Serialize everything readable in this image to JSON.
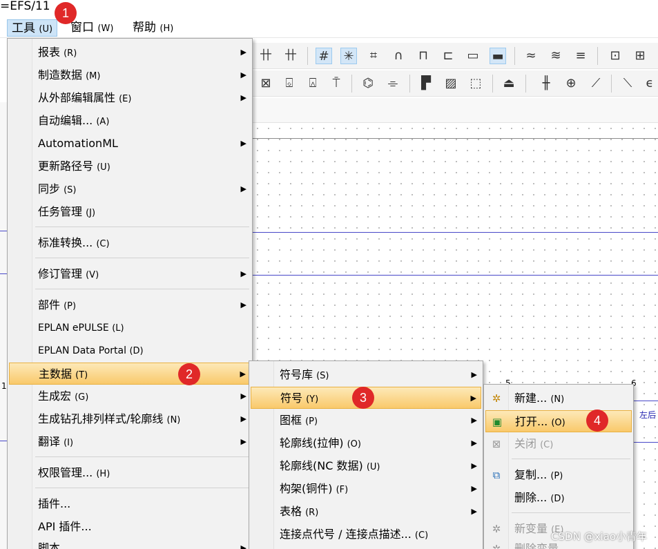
{
  "window": {
    "title": "=EFS/11"
  },
  "menubar": [
    {
      "label": "工具",
      "acc": "(U)",
      "active": true
    },
    {
      "label": "窗口",
      "acc": "(W)"
    },
    {
      "label": "帮助",
      "acc": "(H)"
    }
  ],
  "tools_menu": [
    {
      "label": "报表",
      "acc": "(R)",
      "submenu": true
    },
    {
      "label": "制造数据",
      "acc": "(M)",
      "submenu": true
    },
    {
      "label": "从外部编辑属性",
      "acc": "(E)",
      "submenu": true
    },
    {
      "label": "自动编辑...",
      "acc": "(A)"
    },
    {
      "label": "AutomationML",
      "acc": "",
      "submenu": true
    },
    {
      "label": "更新路径号",
      "acc": "(U)"
    },
    {
      "label": "同步",
      "acc": "(S)",
      "submenu": true
    },
    {
      "label": "任务管理",
      "acc": "(J)"
    },
    {
      "label": "标准转换...",
      "acc": "(C)"
    },
    {
      "label": "修订管理",
      "acc": "(V)",
      "submenu": true
    },
    {
      "label": "部件",
      "acc": "(P)",
      "submenu": true
    },
    {
      "label": "EPLAN ePULSE",
      "acc": "(L)"
    },
    {
      "label": "EPLAN Data Portal",
      "acc": "(D)"
    },
    {
      "label": "主数据",
      "acc": "(T)",
      "submenu": true,
      "highlighted": true
    },
    {
      "label": "生成宏",
      "acc": "(G)",
      "submenu": true
    },
    {
      "label": "生成钻孔排列样式/轮廓线",
      "acc": "(N)",
      "submenu": true
    },
    {
      "label": "翻译",
      "acc": "(I)",
      "submenu": true
    },
    {
      "label": "权限管理...",
      "acc": "(H)"
    },
    {
      "label": "插件...",
      "acc": ""
    },
    {
      "label": "API 插件...",
      "acc": ""
    },
    {
      "label": "脚本",
      "acc": "",
      "submenu": true
    }
  ],
  "masterdata_menu": [
    {
      "label": "符号库",
      "acc": "(S)",
      "submenu": true
    },
    {
      "label": "符号",
      "acc": "(Y)",
      "submenu": true,
      "highlighted": true
    },
    {
      "label": "图框",
      "acc": "(P)",
      "submenu": true
    },
    {
      "label": "轮廓线(拉伸)",
      "acc": "(O)",
      "submenu": true
    },
    {
      "label": "轮廓线(NC 数据)",
      "acc": "(U)",
      "submenu": true
    },
    {
      "label": "构架(铜件)",
      "acc": "(F)",
      "submenu": true
    },
    {
      "label": "表格",
      "acc": "(R)",
      "submenu": true
    },
    {
      "label": "连接点代号 / 连接点描述...",
      "acc": "(C)"
    }
  ],
  "symbol_menu": [
    {
      "label": "新建...",
      "acc": "(N)",
      "icon": "new-symbol-icon"
    },
    {
      "label": "打开...",
      "acc": "(O)",
      "icon": "open-symbol-icon",
      "highlighted": true
    },
    {
      "label": "关闭",
      "acc": "(C)",
      "icon": "close-symbol-icon",
      "disabled": true
    },
    {
      "label": "复制...",
      "acc": "(P)",
      "icon": "copy-symbol-icon"
    },
    {
      "label": "删除...",
      "acc": "(D)"
    },
    {
      "label": "新变量",
      "acc": "(E)",
      "icon": "new-variant-icon",
      "disabled": true
    },
    {
      "label": "删除变量",
      "acc": "",
      "icon": "delete-variant-icon",
      "disabled": true
    }
  ],
  "badges": [
    "1",
    "2",
    "3",
    "4"
  ],
  "canvas": {
    "fragment_text": "左后",
    "ruler_labels": [
      "1",
      "5",
      "6"
    ]
  },
  "watermark": "CSDN @xiao小青年",
  "colors": {
    "badge": "#e02828",
    "highlight": "#f9c96b",
    "wire": "#4747c8"
  }
}
